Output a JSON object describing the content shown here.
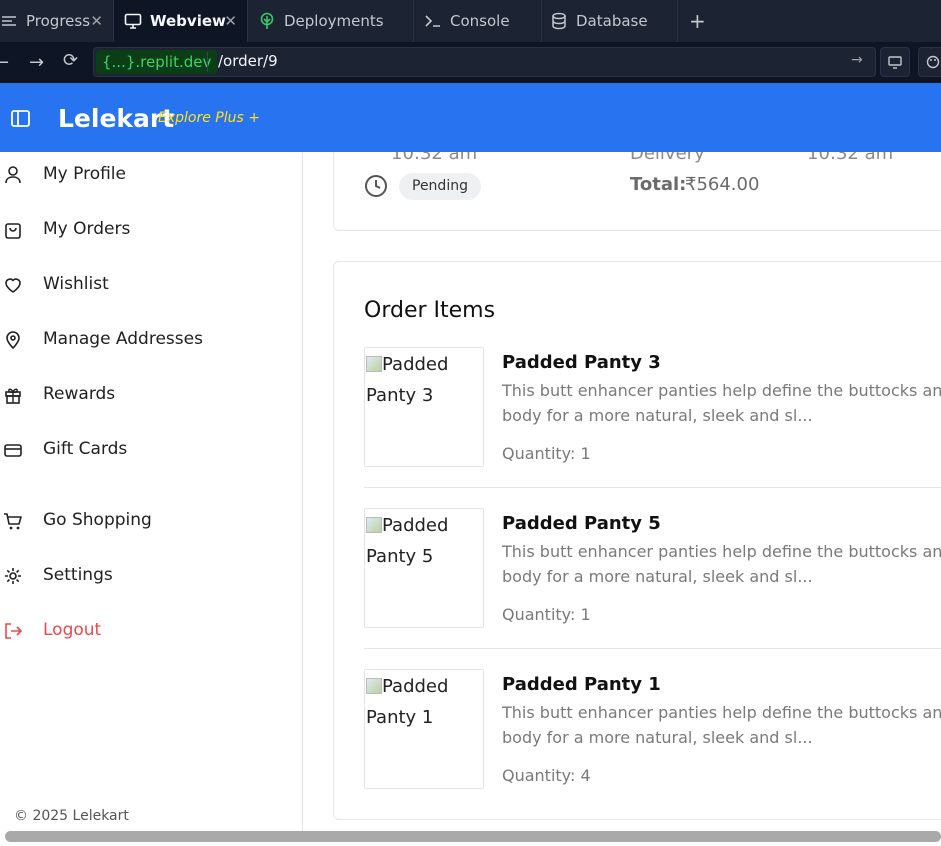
{
  "ide": {
    "tabs": [
      {
        "label": "Progress",
        "closable": true
      },
      {
        "label": "Webview",
        "closable": true,
        "active": true
      },
      {
        "label": "Deployments"
      },
      {
        "label": "Console"
      },
      {
        "label": "Database"
      }
    ],
    "url": {
      "domain": "{...}.replit.dev",
      "path": "/order/9"
    }
  },
  "app": {
    "brand": "Lelekart",
    "tagline": "Explore Plus +"
  },
  "sidebar": {
    "items": [
      {
        "label": "My Profile",
        "icon": "user-icon"
      },
      {
        "label": "My Orders",
        "icon": "bag-icon"
      },
      {
        "label": "Wishlist",
        "icon": "heart-icon"
      },
      {
        "label": "Manage Addresses",
        "icon": "location-pin-icon"
      },
      {
        "label": "Rewards",
        "icon": "gift-icon"
      },
      {
        "label": "Gift Cards",
        "icon": "card-icon"
      },
      {
        "label": "Go Shopping",
        "icon": "cart-icon"
      },
      {
        "label": "Settings",
        "icon": "gear-icon"
      },
      {
        "label": "Logout",
        "icon": "logout-icon"
      }
    ],
    "copyright": "© 2025 Lelekart"
  },
  "order_summary": {
    "time_left": "10:32 am",
    "delivery_label": "Delivery",
    "time_right": "10:32 am",
    "status": "Pending",
    "total_label": "Total:",
    "total_value": "₹564.00"
  },
  "order_items": {
    "title": "Order Items",
    "items": [
      {
        "name": "Padded Panty 3",
        "alt_line1": "Padded",
        "alt_line2": "Panty 3",
        "desc_line1": "This butt enhancer panties help define the buttocks and s",
        "desc_line2": "body for a more natural, sleek and sl...",
        "quantity": "Quantity: 1"
      },
      {
        "name": "Padded Panty 5",
        "alt_line1": "Padded",
        "alt_line2": "Panty 5",
        "desc_line1": "This butt enhancer panties help define the buttocks and s",
        "desc_line2": "body for a more natural, sleek and sl...",
        "quantity": "Quantity: 1"
      },
      {
        "name": "Padded Panty 1",
        "alt_line1": "Padded",
        "alt_line2": "Panty 1",
        "desc_line1": "This butt enhancer panties help define the buttocks and s",
        "desc_line2": "body for a more natural, sleek and sl...",
        "quantity": "Quantity: 4"
      }
    ]
  },
  "colors": {
    "header_blue": "#2874f0",
    "tagline_yellow": "#ffe11b",
    "logout_red": "#e84a4a",
    "replit_dark": "#0e1525"
  }
}
